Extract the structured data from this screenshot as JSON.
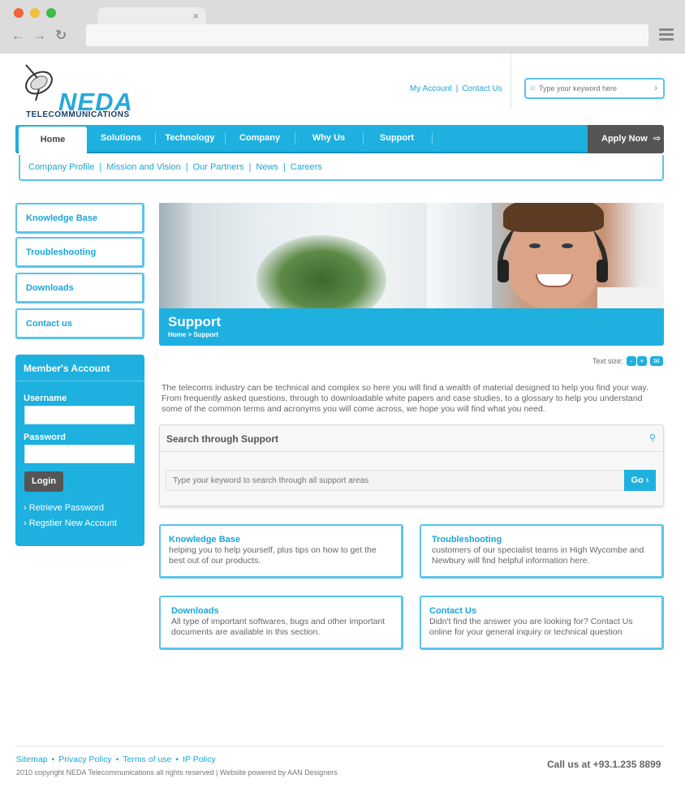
{
  "browser": {
    "tab_close": "×",
    "back": "←",
    "forward": "→",
    "reload": "↻"
  },
  "brand": {
    "logo": "NEDA",
    "tagline": "TELECOMMUNICATIONS"
  },
  "header": {
    "links": [
      "My Account",
      "Contact Us"
    ],
    "search_placeholder": "Type your keyword here",
    "search_go": "›",
    "search_icon": "○"
  },
  "nav": {
    "items": [
      "Home",
      "Solutions",
      "Technology",
      "Company",
      "Why Us",
      "Support"
    ],
    "active": "Home",
    "apply": "Apply Now",
    "apply_icon": "⇨"
  },
  "subnav": [
    "Company Profile",
    "Mission and Vision",
    "Our Partners",
    "News",
    "Careers"
  ],
  "sidebar": {
    "links": [
      "Knowledge Base",
      "Troubleshooting",
      "Downloads",
      "Contact us"
    ],
    "member": {
      "title": "Member's Account",
      "username_label": "Username",
      "password_label": "Password",
      "login": "Login",
      "retrieve": "Retrieve Password",
      "register": "Regstier New Account",
      "arrow": "›"
    }
  },
  "page": {
    "title": "Support",
    "breadcrumb": "Home > Support",
    "text_size_label": "Text size:",
    "text_minus": "-",
    "text_plus": "+",
    "email_icon": "✉",
    "intro": "The telecoms industry can be technical and complex so here you will find a wealth of material designed to help you find your way. From frequently asked questions, through to downloadable white papers and case studies, to a glossary to help you understand some of the common terms and acronyms you will come across, we hope you will find what you need."
  },
  "support_search": {
    "title": "Search through Support",
    "placeholder": "Type your keyword to search through all support areas",
    "go": "Go ›",
    "icon": "⚲"
  },
  "cards": [
    {
      "title": "Knowledge Base",
      "text": "helping you to help yourself, plus tips on how to get the best out of our products."
    },
    {
      "title": "Troubleshooting",
      "text": "customers of our specialist teams in High Wycombe and Newbury will find helpful information here."
    },
    {
      "title": "Downloads",
      "text": "All type of important softwares, bugs and other important documents are available in this section."
    },
    {
      "title": "Contact Us",
      "text": "Didn't find the answer you are looking for? Contact Us online for your general inquiry or technical question"
    }
  ],
  "footer": {
    "links": [
      "Sitemap",
      "Privacy Policy",
      "Terms of use",
      "IP Policy"
    ],
    "bullet": "•",
    "copyright": "2010 copyright NEDA Telecommunications all rights reserved  |  Website powered by AAN Designers",
    "call": "Call us at +93.1.235 8899"
  }
}
